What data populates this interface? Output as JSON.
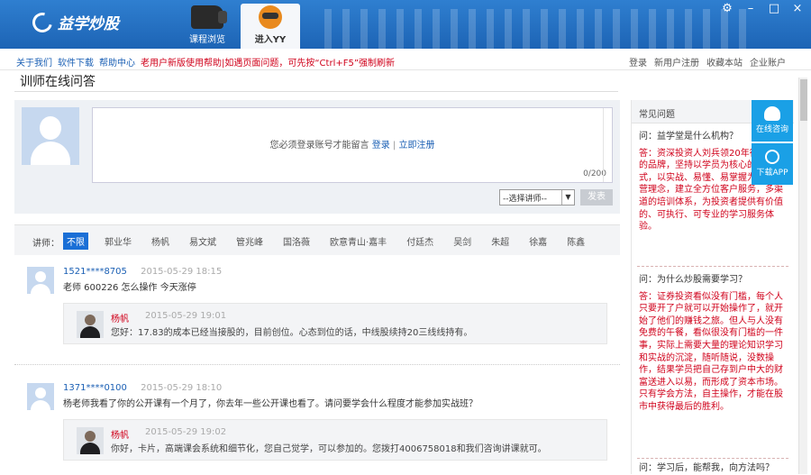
{
  "app": {
    "logo_text": "益学炒股",
    "tabs": [
      {
        "label": "课程浏览",
        "icon": "camera-icon"
      },
      {
        "label": "进入YY",
        "icon": "yy-mascot-icon"
      }
    ],
    "window_buttons": {
      "settings": "⚙",
      "minimize": "–",
      "maximize": "□",
      "close": "×"
    }
  },
  "nav": {
    "left": [
      {
        "label": "关于我们"
      },
      {
        "label": "软件下载"
      },
      {
        "label": "帮助中心"
      }
    ],
    "notice": "老用户新版使用帮助|如遇页面问题，可先按“Ctrl+F5”强制刷新",
    "right": [
      {
        "label": "登录"
      },
      {
        "label": "新用户注册"
      },
      {
        "label": "收藏本站"
      },
      {
        "label": "企业账户"
      }
    ]
  },
  "page": {
    "title": "训师在线问答"
  },
  "compose": {
    "hint_prefix": "您必须登录账号才能留言",
    "login_link": "登录",
    "separator": "|",
    "register_link": "立即注册",
    "char_count": "0/200",
    "teacher_select": "--选择讲师--",
    "submit_label": "发表"
  },
  "filter": {
    "label": "讲师：",
    "items": [
      "不限",
      "郭业华",
      "杨帆",
      "易文斌",
      "管兆峰",
      "国洛薇",
      "欧意青山·嘉丰",
      "付廷杰",
      "吴剑",
      "朱超",
      "徐嘉",
      "陈鑫"
    ],
    "active": "不限"
  },
  "questions": [
    {
      "user": "1521****8705",
      "time": "2015-05-29 18:15",
      "text": "老师 600226 怎么操作 今天涨停",
      "reply": {
        "name": "杨帆",
        "time": "2015-05-29 19:01",
        "text": "您好：17.83的成本已经当接股的，目前创位。心态到位的话，中线股续持20三线线持有。"
      }
    },
    {
      "user": "1371****0100",
      "time": "2015-05-29 18:10",
      "text": "杨老师我看了你的公开课有一个月了，你去年一些公开课也看了。请问要学会什么程度才能参加实战班？",
      "reply": {
        "name": "杨帆",
        "time": "2015-05-29 19:02",
        "text": "你好，卡片，高端课会系统和细节化，您自己觉学，可以参加的。您拨打4006758018和我们咨询讲课就可。"
      }
    }
  ],
  "sidebar": {
    "title": "常见问题",
    "faqs": [
      {
        "q": "问：益学堂是什么机构？",
        "a": "答：资深投资人刘兵领20年行情创办的品牌，坚持以学员为核心的培训模式，以实战、易懂、易掌握为根本经营理念，建立全方位客户服务，多渠道的培训体系，为投资者提供有价值的、可执行、可专业的学习服务体验。"
      },
      {
        "q": "问：为什么炒股需要学习？",
        "a": "答：证券投资看似没有门槛，每个人只要开了户就可以开始操作了，就开始了他们的赚钱之旅。但人与人没有免费的午餐，看似很没有门槛的一件事，实际上需要大量的理论知识学习和实战的沉淀，随听随说，没数操作，结果学员把自己存到户中大的财富送进入以易，而形成了资本市场。只有学会方法，自主操作，才能在股市中获得最后的胜利。"
      },
      {
        "q": "问：学习后，能帮我，向方法吗？"
      }
    ]
  },
  "float": {
    "consult": "在线咨询",
    "app": "下载APP"
  }
}
